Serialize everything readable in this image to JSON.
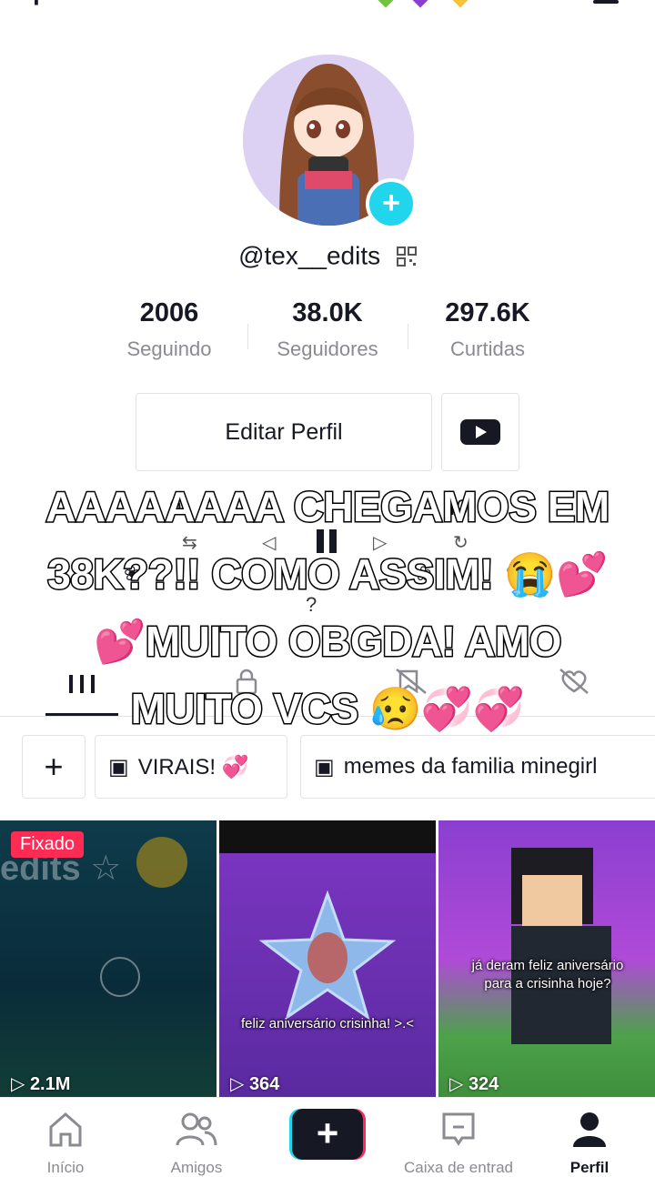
{
  "profile": {
    "username": "@tex__edits",
    "stats": [
      {
        "value": "2006",
        "label": "Seguindo"
      },
      {
        "value": "38.0K",
        "label": "Seguidores"
      },
      {
        "value": "297.6K",
        "label": "Curtidas"
      }
    ],
    "edit_button": "Editar Perfil"
  },
  "background_bio": {
    "line1_start": "0",
    "line1_end": "40",
    "line3": "?"
  },
  "playlists": {
    "add": "+",
    "items": [
      "VIRAIS! 💞",
      "memes da familia minegirl"
    ]
  },
  "videos": [
    {
      "views": "2.1M",
      "pinned": "Fixado",
      "caption": ""
    },
    {
      "views": "364",
      "caption": "feliz aniversário crisinha! >.<"
    },
    {
      "views": "324",
      "caption": "já deram feliz aniversário para a crisinha hoje?"
    }
  ],
  "nav": [
    {
      "label": "Início",
      "icon": "home-icon"
    },
    {
      "label": "Amigos",
      "icon": "friends-icon"
    },
    {
      "label": "",
      "icon": "create-plus-icon"
    },
    {
      "label": "Caixa de entrad",
      "icon": "inbox-icon"
    },
    {
      "label": "Perfil",
      "icon": "profile-icon"
    }
  ],
  "overlay_text": "AAAAAAAA CHEGAMOS EM 38K??!! COMO ASSIM! 😭💕💕MUITO OBGDA! AMO MUITO VCS 😥💞💞",
  "colors": {
    "accent": "#fe2c55",
    "cyan": "#20d5ec",
    "text": "#161823",
    "muted": "#8a8b91"
  }
}
